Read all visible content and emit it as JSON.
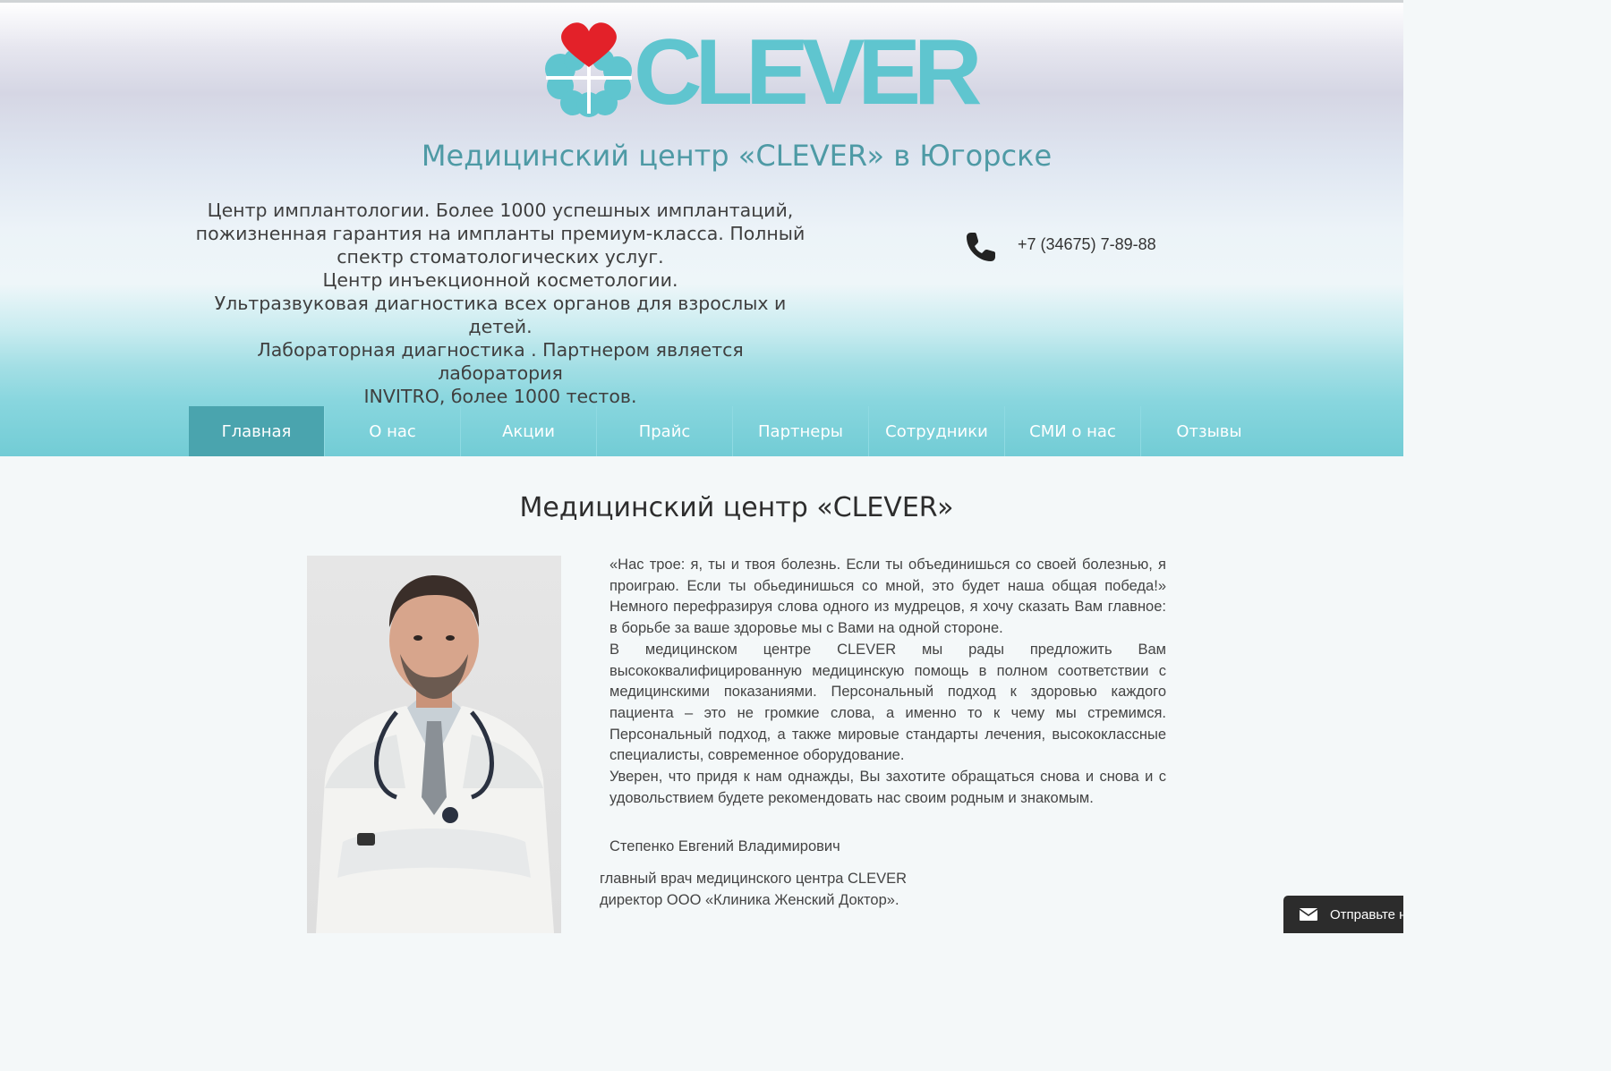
{
  "header": {
    "logo_text": "CLEVER",
    "site_title": "Медицинский центр «CLEVER» в Югорске",
    "tagline_lines": [
      "Центр имплантологии. Более 1000 успешных имплантаций,",
      "пожизненная гарантия на импланты премиум-класса. Полный",
      "спектр стоматологических услуг.",
      "Центр инъекционной косметологии.",
      "Ультразвуковая диагностика всех органов для взрослых и детей.",
      " Лабораторная диагностика . Партнером является лаборатория",
      "INVITRO, более 1000 тестов."
    ],
    "phone_icon": "phone-icon",
    "phone": "+7 (34675) 7-89-88"
  },
  "nav": {
    "items": [
      {
        "label": "Главная",
        "active": true
      },
      {
        "label": "О нас"
      },
      {
        "label": "Акции"
      },
      {
        "label": "Прайс"
      },
      {
        "label": "Партнеры"
      },
      {
        "label": "Сотрудники"
      },
      {
        "label": "СМИ о нас"
      },
      {
        "label": "Отзывы"
      }
    ]
  },
  "main": {
    "heading": "Медицинский центр «CLEVER»",
    "quote_paragraphs": [
      "«Нас трое: я, ты и твоя болезнь. Если ты объединишься со своей болезнью, я проиграю. Если ты обьединишься со мной, это будет наша общая победа!» Немного перефразируя слова одного из мудрецов, я хочу сказать Вам главное: в борьбе за ваше здоровье мы с Вами на одной стороне.",
      "В медицинском центре CLEVER мы рады предложить Вам высококвалифицированную медицинскую помощь в полном соответствии с медицинскими показаниями. Персональный подход к здоровью каждого пациента – это не громкие слова, а именно то к чему мы стремимся. Персональный подход, а также мировые стандарты лечения, высококлассные специалисты, современное оборудование.",
      "Уверен, что придя к нам однажды, Вы захотите обращаться снова и снова и с удовольствием будете рекомендовать нас своим родным и знакомым."
    ],
    "signature_name": "Степенко Евгений Владимирович",
    "signature_title_lines": [
      "главный врач медицинского центра CLEVER",
      "директор ООО «Клиника Женский Доктор»."
    ]
  },
  "chat_widget": {
    "icon": "envelope-icon",
    "label": "Отправьте н"
  },
  "colors": {
    "brand_teal": "#5fc5cf",
    "heart_red": "#e32129",
    "nav_bg": "#72ccd5",
    "nav_active": "#4aa4ae",
    "title_teal": "#4e9aa5"
  }
}
